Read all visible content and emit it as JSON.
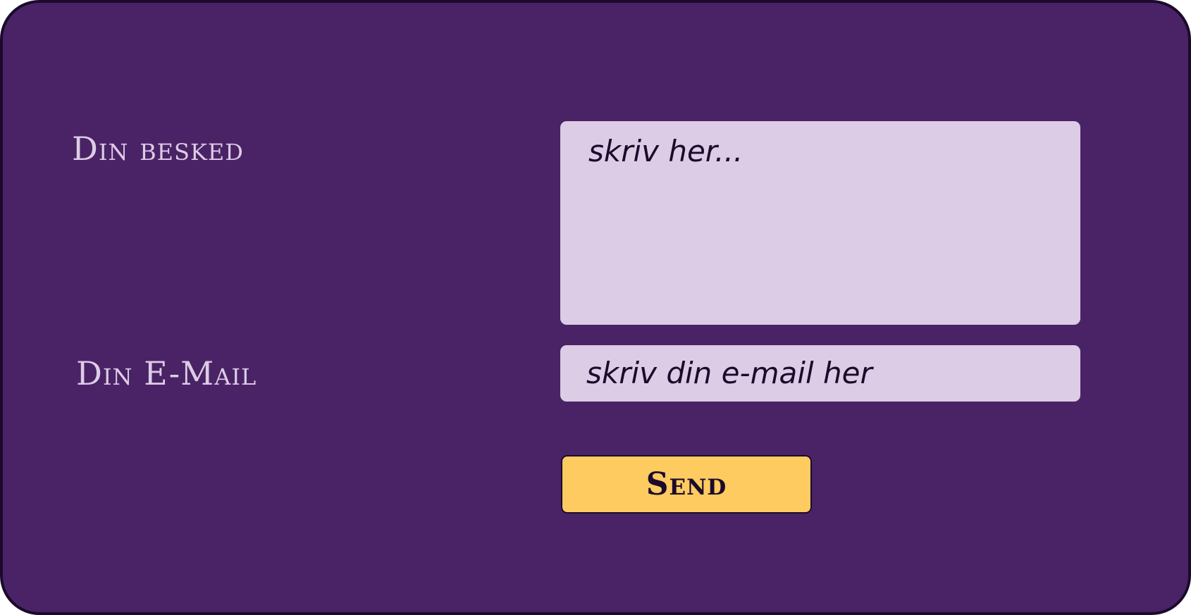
{
  "form": {
    "message_label": "Din besked",
    "message_placeholder": "skriv her...",
    "email_label": "Din E-Mail",
    "email_placeholder": "skriv din e-mail her",
    "send_label": "Send"
  },
  "colors": {
    "panel_background": "#4a2366",
    "panel_border": "#1c0a2c",
    "label_text": "#ddcce6",
    "field_background": "#dccce6",
    "field_text": "#1c0a2c",
    "button_background": "#fdcb5f",
    "button_text": "#1c0a2c"
  }
}
